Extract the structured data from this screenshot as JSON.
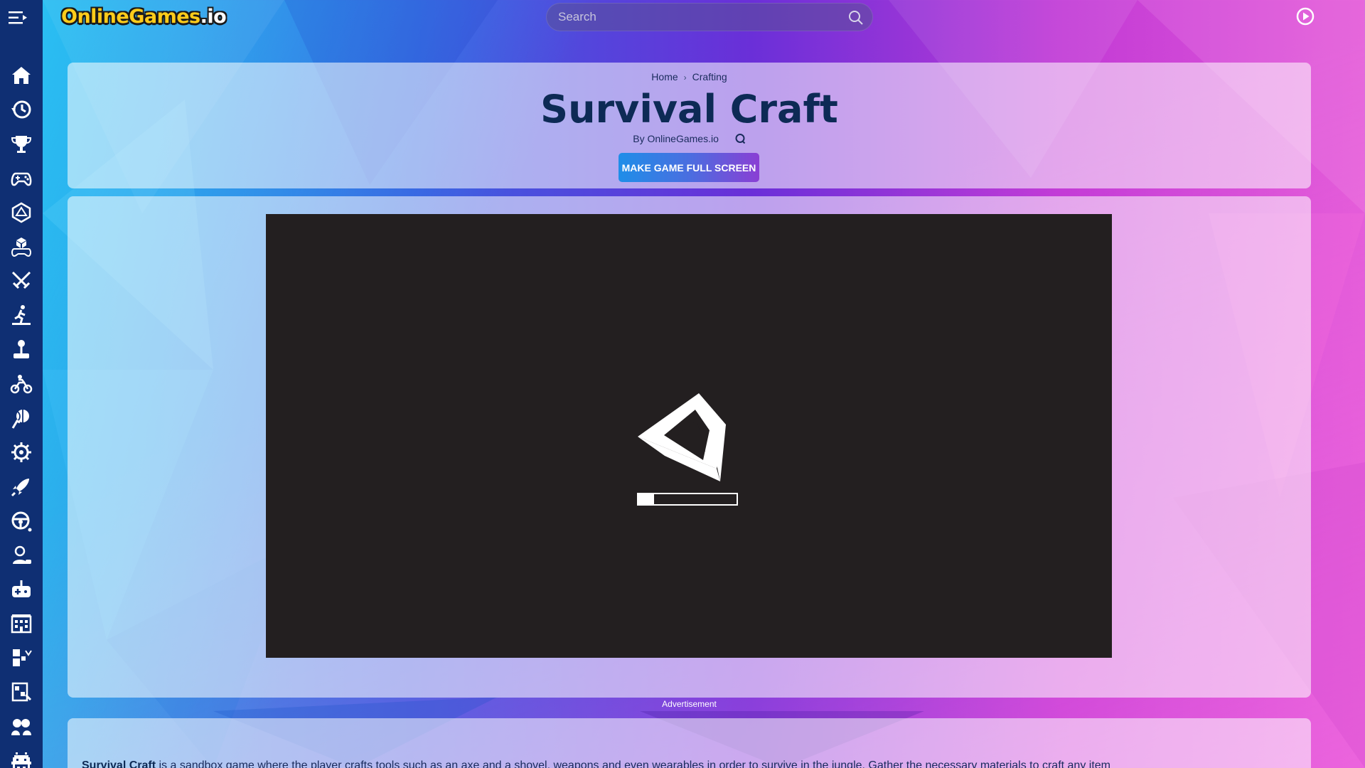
{
  "site": {
    "logo_main": "OnlineGames",
    "logo_tld": ".io"
  },
  "search": {
    "placeholder": "Search"
  },
  "sidebar": {
    "items": [
      {
        "icon": "home-icon"
      },
      {
        "icon": "history-icon"
      },
      {
        "icon": "trophy-icon"
      },
      {
        "icon": "gamepad-icon"
      },
      {
        "icon": "d20-dice-icon"
      },
      {
        "icon": "cube-controller-icon"
      },
      {
        "icon": "crossed-swords-icon"
      },
      {
        "icon": "runner-icon"
      },
      {
        "icon": "joystick-icon"
      },
      {
        "icon": "motorbike-icon"
      },
      {
        "icon": "basketball-hand-icon"
      },
      {
        "icon": "gear-icon"
      },
      {
        "icon": "rocket-icon"
      },
      {
        "icon": "steering-wheel-icon"
      },
      {
        "icon": "character-icon"
      },
      {
        "icon": "controller-plus-icon"
      },
      {
        "icon": "building-icon"
      },
      {
        "icon": "blocks-icon"
      },
      {
        "icon": "puzzle-icon"
      },
      {
        "icon": "two-players-icon"
      },
      {
        "icon": "space-invader-icon"
      }
    ]
  },
  "breadcrumb": {
    "home": "Home",
    "sep": "›",
    "category": "Crafting"
  },
  "game": {
    "title": "Survival Craft",
    "byline": "By OnlineGames.io",
    "fullscreen_label": "MAKE GAME FULL SCREEN",
    "loading_progress": 0.16
  },
  "ad": {
    "label": "Advertisement"
  },
  "description": {
    "game_name": "Survival Craft",
    "text": " is a sandbox game where the player crafts tools such as an axe and a shovel, weapons and even wearables in order to survive in the jungle. Gather the necessary materials to craft any item"
  },
  "colors": {
    "sidebar": "#0f2f73",
    "title": "#0d2a55",
    "game_bg": "#231f20",
    "button_start": "#1f8ee8",
    "button_end": "#8a3fd4"
  }
}
